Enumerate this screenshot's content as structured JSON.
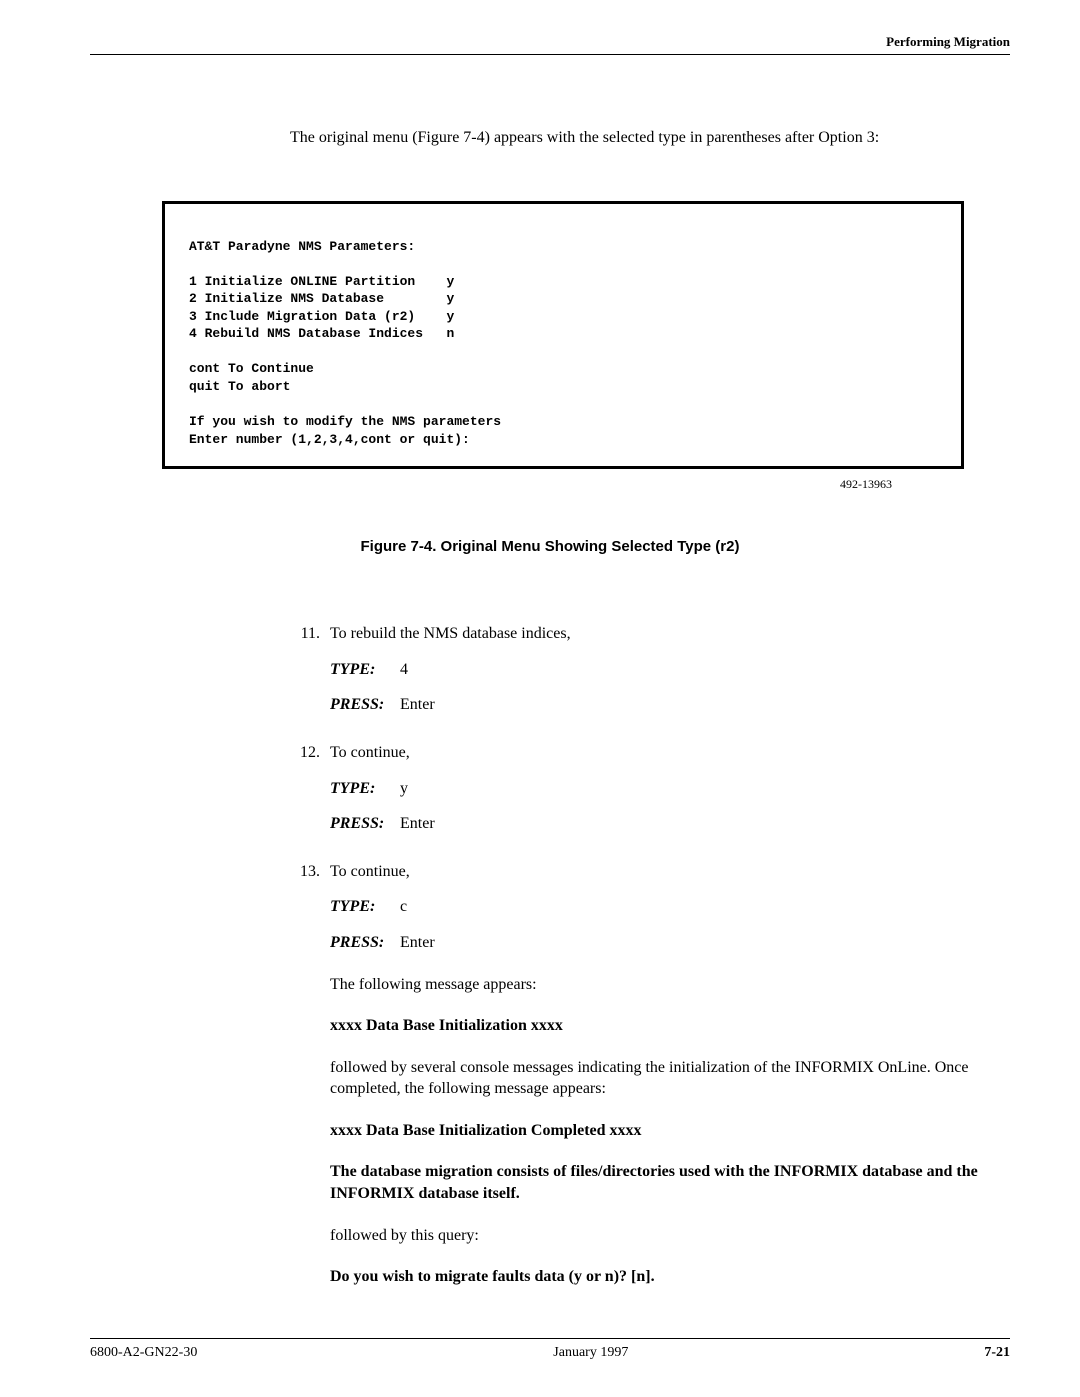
{
  "header": {
    "section": "Performing Migration"
  },
  "intro": "The original menu (Figure 7-4) appears with the selected type in parentheses after Option 3:",
  "terminal": {
    "title": "AT&T Paradyne NMS Parameters:",
    "rows": [
      {
        "n": "1",
        "label": "Initialize ONLINE Partition",
        "val": "y"
      },
      {
        "n": "2",
        "label": "Initialize NMS Database",
        "val": "y"
      },
      {
        "n": "3",
        "label": "Include Migration Data (r2)",
        "val": "y"
      },
      {
        "n": "4",
        "label": "Rebuild NMS Database Indices",
        "val": "n"
      }
    ],
    "cont": "cont To Continue",
    "quit": "quit To abort",
    "modify": "If you wish to modify the NMS parameters",
    "prompt": "Enter number (1,2,3,4,cont or quit):"
  },
  "figure_id": "492-13963",
  "figure_caption": "Figure 7-4.  Original Menu Showing Selected Type (r2)",
  "labels": {
    "type": "TYPE:",
    "press": "PRESS:",
    "enter": "Enter"
  },
  "steps": [
    {
      "num": "11.",
      "lead": "To rebuild the NMS database indices,",
      "type_val": "4",
      "press_val": "Enter"
    },
    {
      "num": "12.",
      "lead": "To continue,",
      "type_val": "y",
      "press_val": "Enter"
    },
    {
      "num": "13.",
      "lead": "To continue,",
      "type_val": "c",
      "press_val": "Enter",
      "after": [
        {
          "text": "The following message appears:",
          "bold": false
        },
        {
          "text": "xxxx Data Base Initialization xxxx",
          "bold": true
        },
        {
          "text": "followed by several console messages indicating the initialization of the INFORMIX OnLine. Once completed, the following message appears:",
          "bold": false
        },
        {
          "text": "xxxx Data Base Initialization Completed xxxx",
          "bold": true
        },
        {
          "text": "The database migration consists of files/directories used with the INFORMIX database and the INFORMIX database itself.",
          "bold": true
        },
        {
          "text": "followed by this query:",
          "bold": false
        },
        {
          "text": "Do you wish to migrate faults data (y or n)? [n].",
          "bold": true
        }
      ]
    }
  ],
  "footer": {
    "left": "6800-A2-GN22-30",
    "center": "January 1997",
    "right": "7-21"
  }
}
